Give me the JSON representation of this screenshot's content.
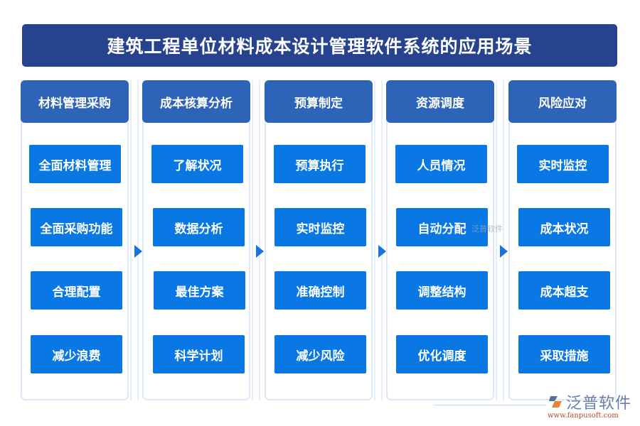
{
  "title": "建筑工程单位材料成本设计管理软件系统的应用场景",
  "columns": [
    {
      "header": "材料管理采购",
      "items": [
        "全面材料管理",
        "全面采购功能",
        "合理配置",
        "减少浪费"
      ]
    },
    {
      "header": "成本核算分析",
      "items": [
        "了解状况",
        "数据分析",
        "最佳方案",
        "科学计划"
      ]
    },
    {
      "header": "预算制定",
      "items": [
        "预算执行",
        "实时监控",
        "准确控制",
        "减少风险"
      ]
    },
    {
      "header": "资源调度",
      "items": [
        "人员情况",
        "自动分配",
        "调整结构",
        "优化调度"
      ]
    },
    {
      "header": "风险应对",
      "items": [
        "实时监控",
        "成本状况",
        "成本超支",
        "采取措施"
      ]
    }
  ],
  "arrows": [
    "arrow-right-icon",
    "arrow-right-icon",
    "arrow-right-icon",
    "arrow-right-icon"
  ],
  "watermark": {
    "text": "泛普软件"
  },
  "brand": {
    "name": "泛普软件",
    "url": "www.fanpusoft.com",
    "logo_icon": "fanpu-logo-icon"
  },
  "colors": {
    "title_bg": "#27438e",
    "header_bg": "#2d64b8",
    "item_bg": "#0978e4",
    "border": "#dde9f8"
  }
}
